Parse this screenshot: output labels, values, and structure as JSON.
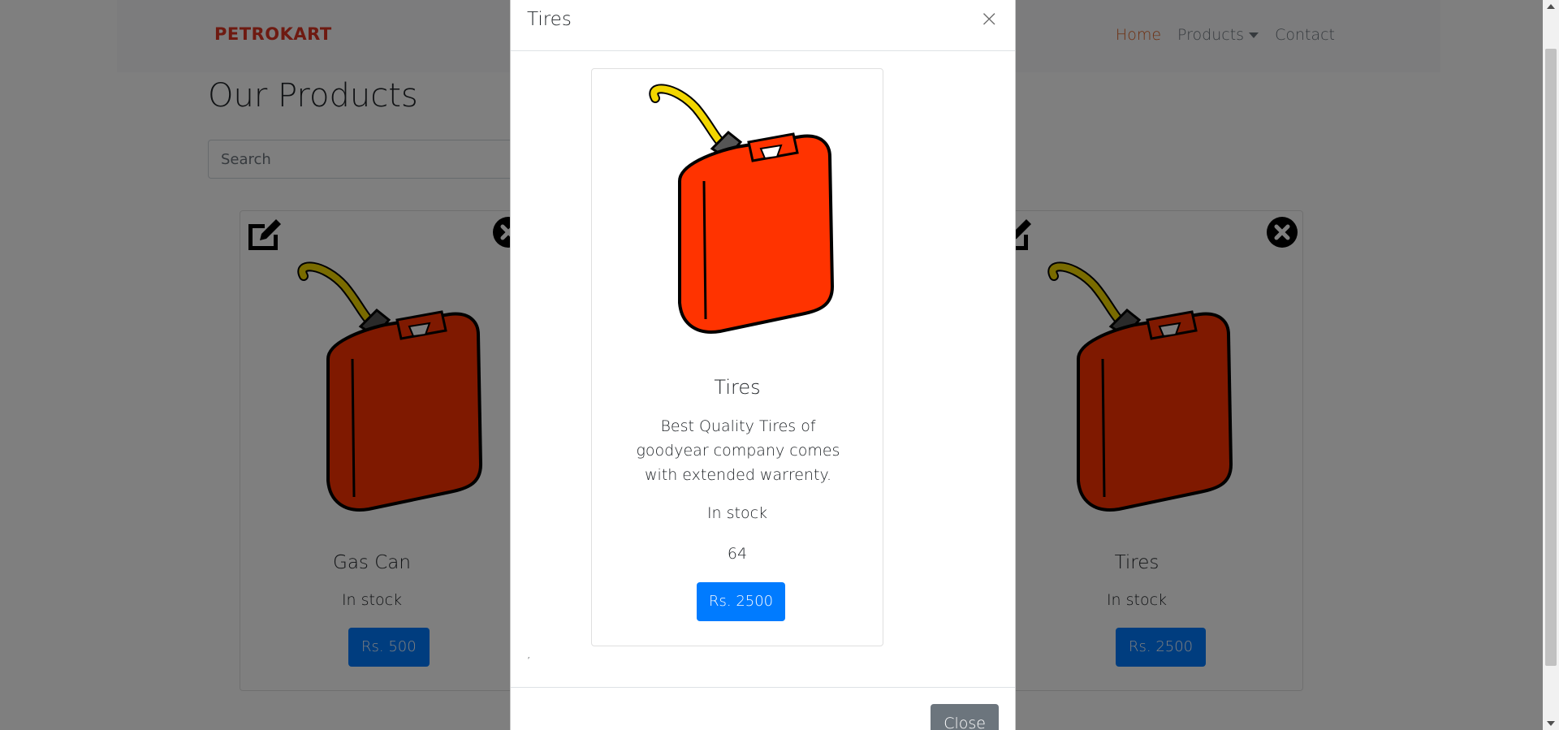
{
  "navbar": {
    "brand": "PETROKART",
    "links": [
      {
        "label": "Home"
      },
      {
        "label": "Products"
      },
      {
        "label": "Contact"
      }
    ]
  },
  "page": {
    "title": "Our Products",
    "search_placeholder": "Search"
  },
  "products": [
    {
      "name": "Gas Can",
      "stock": "In stock",
      "price": "Rs. 500"
    },
    {
      "name": "Tires",
      "stock": "In stock",
      "price": "Rs. 2500"
    }
  ],
  "modal": {
    "title": "Tires",
    "close_x": "×",
    "product": {
      "name": "Tires",
      "description": "Best Quality Tires of goodyear company comes with extended warrenty.",
      "stock": "In stock",
      "quantity": "64",
      "price": "Rs. 2500"
    },
    "stray_text": ",",
    "close_label": "Close"
  },
  "colors": {
    "brand": "#dc3522",
    "primary": "#007bff",
    "secondary": "#6c757d",
    "nav_active": "#dc5f22",
    "can_body": "#ff3300",
    "can_spout": "#f2d600"
  },
  "icons": [
    "edit-icon",
    "delete-circle-icon",
    "gas-can-icon",
    "close-icon"
  ]
}
